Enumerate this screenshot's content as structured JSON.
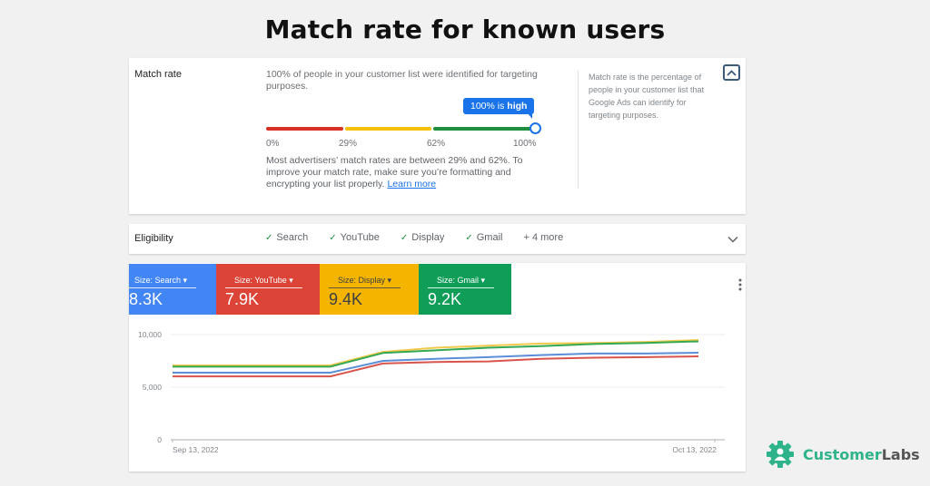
{
  "page_title": "Match rate for known users",
  "match_rate": {
    "label": "Match rate",
    "description": "100% of people in your customer list were identified for targeting purposes.",
    "tooltip_prefix": "100% is ",
    "tooltip_strong": "high",
    "value_percent": 100,
    "scale_ticks": [
      "0%",
      "29%",
      "62%",
      "100%"
    ],
    "segment_colors": {
      "low": "#d93025",
      "medium": "#f4c20d",
      "high": "#1e8e3e"
    },
    "note": "Most advertisers’ match rates are between 29% and 62%. To improve your match rate, make sure you’re formatting and encrypting your list properly. ",
    "learn_more": "Learn more",
    "side_help": "Match rate is the percentage of people in your customer list that Google Ads can identify for targeting purposes."
  },
  "eligibility": {
    "label": "Eligibility",
    "items": [
      "Search",
      "YouTube",
      "Display",
      "Gmail"
    ],
    "more": "+ 4 more"
  },
  "metrics": [
    {
      "selector": "Size: Search",
      "value": "8.3K",
      "color": "#4285f4"
    },
    {
      "selector": "Size: YouTube",
      "value": "7.9K",
      "color": "#db4437"
    },
    {
      "selector": "Size: Display",
      "value": "9.4K",
      "color": "#f4b400"
    },
    {
      "selector": "Size: Gmail",
      "value": "9.2K",
      "color": "#0f9d58"
    }
  ],
  "chart_data": {
    "type": "line",
    "title": "",
    "xlabel": "",
    "ylabel": "",
    "ylim": [
      0,
      10000
    ],
    "y_ticks": [
      0,
      5000,
      10000
    ],
    "y_tick_labels": [
      "0",
      "5,000",
      "10,000"
    ],
    "x_tick_labels": [
      "Sep 13, 2022",
      "Oct 13, 2022"
    ],
    "grid": true,
    "legend": "none",
    "x": [
      "Sep 13",
      "Sep 16",
      "Sep 19",
      "Sep 22",
      "Sep 25",
      "Sep 28",
      "Oct 1",
      "Oct 4",
      "Oct 7",
      "Oct 10",
      "Oct 13"
    ],
    "series": [
      {
        "name": "Display",
        "color": "#f2c94c",
        "values": [
          7070,
          7070,
          7070,
          7070,
          8350,
          8750,
          8950,
          9150,
          9200,
          9300,
          9480
        ]
      },
      {
        "name": "Gmail",
        "color": "#34a853",
        "values": [
          6950,
          6950,
          6950,
          6950,
          8250,
          8500,
          8750,
          8900,
          9100,
          9200,
          9350
        ]
      },
      {
        "name": "Search",
        "color": "#5b8ed6",
        "values": [
          6380,
          6380,
          6380,
          6380,
          7500,
          7700,
          7850,
          8050,
          8200,
          8200,
          8280
        ]
      },
      {
        "name": "YouTube",
        "color": "#d9544a",
        "values": [
          6030,
          6030,
          6030,
          6030,
          7250,
          7400,
          7450,
          7700,
          7800,
          7850,
          7930
        ]
      }
    ]
  },
  "brand": {
    "name_primary": "Customer",
    "name_secondary": "Labs",
    "primary_color": "#2fb38a",
    "secondary_color": "#555555"
  }
}
